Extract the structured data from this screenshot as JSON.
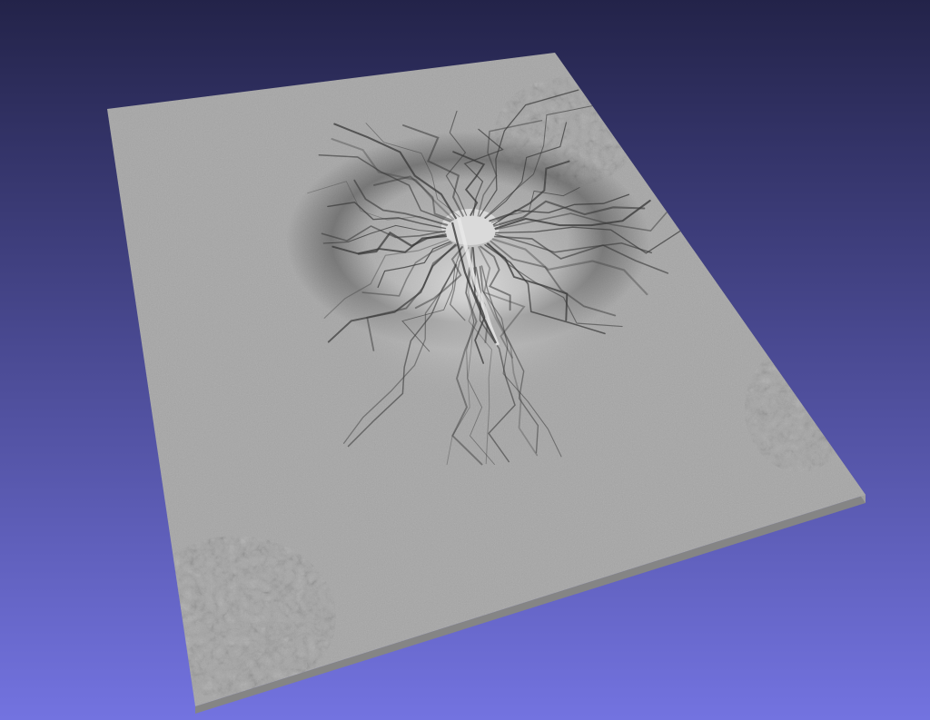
{
  "viewer": {
    "background": {
      "top_color": "#232349",
      "bottom_color": "#7373e0"
    },
    "model": {
      "surface_color": "#a6a6a6",
      "edge_light_color": "#9e9e9e",
      "edge_dark_color": "#858585",
      "crevasse_color": "#3a3a3a",
      "highlight_color": "#d2d2d2"
    }
  }
}
